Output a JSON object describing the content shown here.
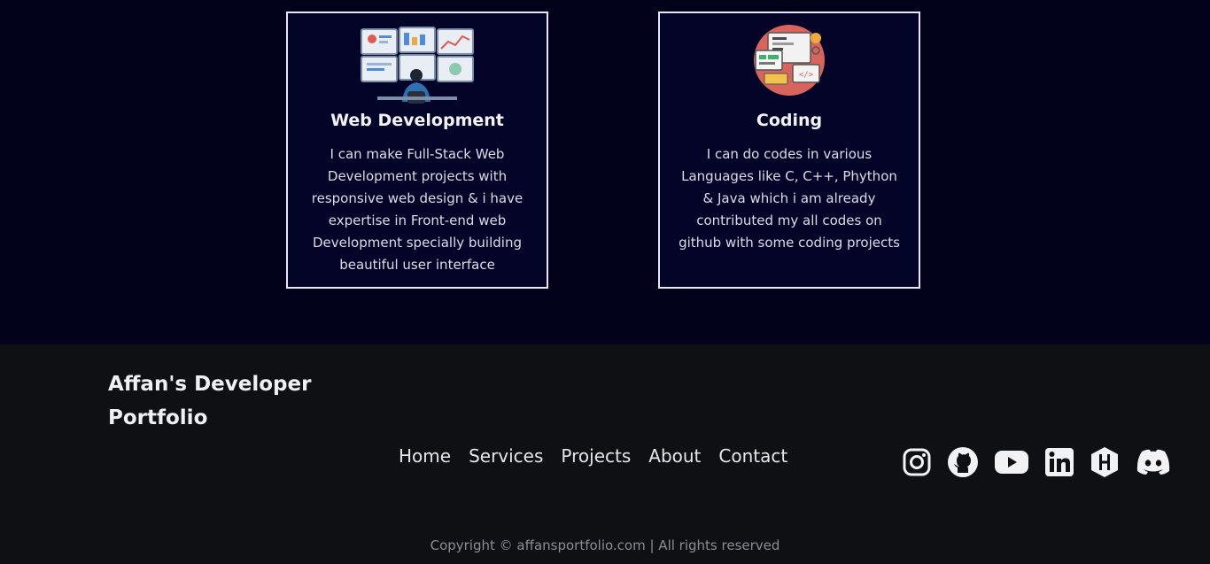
{
  "services": {
    "cards": [
      {
        "title": "Web Development",
        "description": "I can make Full-Stack Web Development projects with responsive web design & i have expertise in Front-end web Development specially building beautiful user interface",
        "illustration": "monitors-developer-illustration"
      },
      {
        "title": "Coding",
        "description": "I can do codes in various Languages like C, C++, Phython & Java which i am already contributed my all codes on github with some coding projects",
        "illustration": "coding-devices-illustration"
      }
    ]
  },
  "footer": {
    "brand": "Affan's Developer Portfolio",
    "nav": [
      "Home",
      "Services",
      "Projects",
      "About",
      "Contact"
    ],
    "socials": [
      "instagram-icon",
      "github-icon",
      "youtube-icon",
      "linkedin-icon",
      "hashnode-icon",
      "discord-icon"
    ],
    "copyright": "Copyright © affansportfolio.com | All rights reserved"
  },
  "colors": {
    "services_bg": "#02021b",
    "card_bg": "#040428",
    "card_border": "#e8e8ef",
    "footer_bg": "#0f1014",
    "muted_text": "#8c8c93"
  }
}
